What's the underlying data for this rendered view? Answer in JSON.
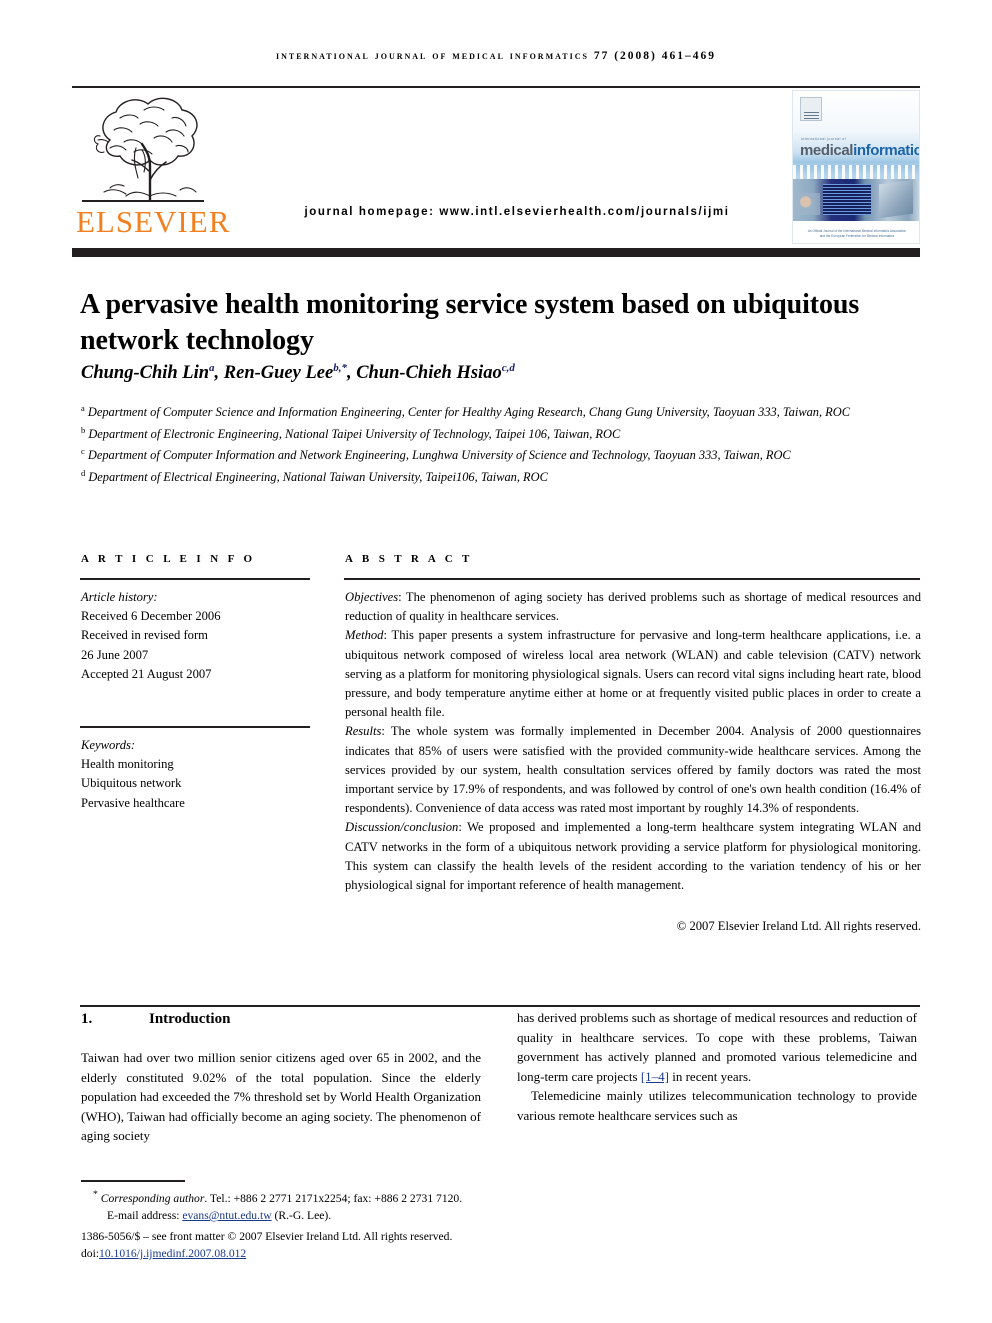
{
  "running_head": "international journal of medical informatics 77 (2008) 461–469",
  "masthead": {
    "publisher_wordmark": "ELSEVIER",
    "homepage_line": "journal homepage: www.intl.elsevierhealth.com/journals/ijmi",
    "cover": {
      "eyebrow": "international journal of",
      "title_first": "medical",
      "title_second": "informatics",
      "footnote": "An Official Journal of the International Medical Informatics Association and the European Federation for Medical Informatics"
    }
  },
  "article": {
    "title": "A pervasive health monitoring service system based on ubiquitous network technology",
    "authors_html": "Chung-Chih Lin<sup>a</sup>, Ren-Guey Lee<sup>b,*</sup>, Chun-Chieh Hsiao<sup>c,d</sup>",
    "affiliations": [
      {
        "marker": "a",
        "text": "Department of Computer Science and Information Engineering, Center for Healthy Aging Research, Chang Gung University, Taoyuan 333, Taiwan, ROC"
      },
      {
        "marker": "b",
        "text": "Department of Electronic Engineering, National Taipei University of Technology, Taipei 106, Taiwan, ROC"
      },
      {
        "marker": "c",
        "text": "Department of Computer Information and Network Engineering, Lunghwa University of Science and Technology, Taoyuan 333, Taiwan, ROC"
      },
      {
        "marker": "d",
        "text": "Department of Electrical Engineering, National Taiwan University, Taipei106, Taiwan, ROC"
      }
    ]
  },
  "article_info": {
    "heading": "A R T I C L E    I N F O",
    "history_label": "Article history:",
    "history": [
      "Received 6 December 2006",
      "Received in revised form",
      "26 June 2007",
      "Accepted 21 August 2007"
    ],
    "keywords_label": "Keywords:",
    "keywords": [
      "Health monitoring",
      "Ubiquitous network",
      "Pervasive healthcare"
    ]
  },
  "abstract": {
    "heading": "A B S T R A C T",
    "objectives_label": "Objectives",
    "objectives_text": ": The phenomenon of aging society has derived problems such as shortage of medical resources and reduction of quality in healthcare services.",
    "method_label": "Method",
    "method_text": ": This paper presents a system infrastructure for pervasive and long-term healthcare applications, i.e. a ubiquitous network composed of wireless local area network (WLAN) and cable television (CATV) network serving as a platform for monitoring physiological signals. Users can record vital signs including heart rate, blood pressure, and body temperature anytime either at home or at frequently visited public places in order to create a personal health file.",
    "results_label": "Results",
    "results_text": ": The whole system was formally implemented in December 2004. Analysis of 2000 questionnaires indicates that 85% of users were satisfied with the provided community-wide healthcare services. Among the services provided by our system, health consultation services offered by family doctors was rated the most important service by 17.9% of respondents, and was followed by control of one's own health condition (16.4% of respondents). Convenience of data access was rated most important by roughly 14.3% of respondents.",
    "discussion_label": "Discussion/conclusion",
    "discussion_text": ": We proposed and implemented a long-term healthcare system integrating WLAN and CATV networks in the form of a ubiquitous network providing a service platform for physiological monitoring. This system can classify the health levels of the resident according to the variation tendency of his or her physiological signal for important reference of health management.",
    "copyright": "© 2007 Elsevier Ireland Ltd. All rights reserved."
  },
  "body": {
    "section_number": "1.",
    "section_title": "Introduction",
    "left_paragraph": "Taiwan had over two million senior citizens aged over 65 in 2002, and the elderly constituted 9.02% of the total population. Since the elderly population had exceeded the 7% threshold set by World Health Organization (WHO), Taiwan had officially become an aging society. The phenomenon of aging society",
    "right_paragraph_1_before": "has derived problems such as shortage of medical resources and reduction of quality in healthcare services. To cope with these problems, Taiwan government has actively planned and promoted various telemedicine and long-term care projects ",
    "right_citation": "[1–4]",
    "right_paragraph_1_after": " in recent years.",
    "right_paragraph_2": "Telemedicine mainly utilizes telecommunication technology to provide various remote healthcare services such as"
  },
  "footer": {
    "corresponding_marker": "*",
    "corresponding_label": "Corresponding author",
    "corresponding_text": ". Tel.: +886 2 2771 2171x2254; fax: +886 2 2731 7120.",
    "email_label": "E-mail address: ",
    "email": "evans@ntut.edu.tw",
    "email_suffix": " (R.-G. Lee).",
    "front_matter": "1386-5056/$ – see front matter © 2007 Elsevier Ireland Ltd. All rights reserved.",
    "doi_label": "doi:",
    "doi": "10.1016/j.ijmedinf.2007.08.012"
  },
  "colors": {
    "elsevier_orange": "#f28020",
    "rule_black": "#231f20",
    "link_blue": "#1a3a8f",
    "cover_blue": "#1c63a8"
  }
}
